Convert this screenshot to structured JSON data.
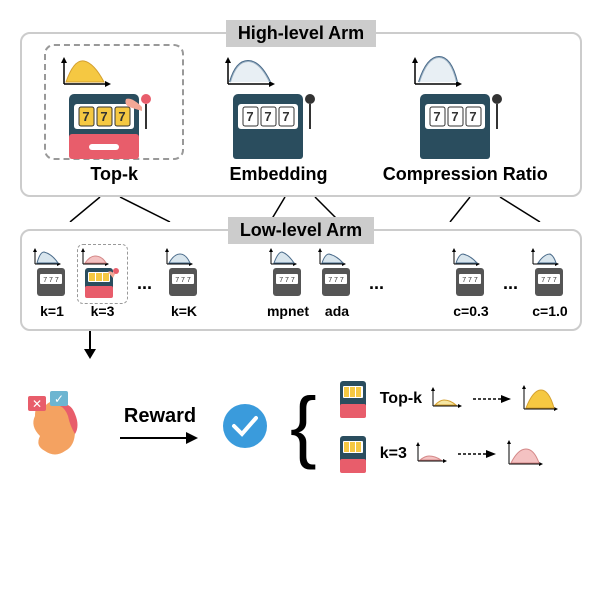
{
  "sections": {
    "high_level": "High-level Arm",
    "low_level": "Low-level Arm"
  },
  "high_arms": [
    {
      "name": "Top-k",
      "selected": true,
      "color": "yellow"
    },
    {
      "name": "Embedding",
      "selected": false,
      "color": "blue"
    },
    {
      "name": "Compression Ratio",
      "selected": false,
      "color": "blue"
    }
  ],
  "low_arms": {
    "topk": [
      {
        "label": "k=1",
        "color": "blue"
      },
      {
        "label": "k=3",
        "color": "pink",
        "selected": true
      },
      {
        "label": "k=K",
        "color": "blue"
      }
    ],
    "embedding": [
      {
        "label": "mpnet",
        "color": "blue"
      },
      {
        "label": "ada",
        "color": "blue"
      }
    ],
    "compression": [
      {
        "label": "c=0.3",
        "color": "blue"
      },
      {
        "label": "c=1.0",
        "color": "blue"
      }
    ]
  },
  "reward_label": "Reward",
  "updates": [
    {
      "label": "Top-k",
      "color": "yellow"
    },
    {
      "label": "k=3",
      "color": "pink"
    }
  ],
  "chart_data": {
    "type": "diagram",
    "description": "Hierarchical multi-armed bandit structure. High-level arms select hyperparameter dimension (Top-k, Embedding, Compression Ratio). Low-level arms select specific values within the chosen dimension. Selected arm (Top-k → k=3) is evaluated and reward updates posterior distributions for both the high-level Top-k arm and low-level k=3 arm.",
    "high_level_options": [
      "Top-k",
      "Embedding",
      "Compression Ratio"
    ],
    "low_level_options": {
      "Top-k": [
        "k=1",
        "k=3",
        "k=K"
      ],
      "Embedding": [
        "mpnet",
        "ada"
      ],
      "Compression Ratio": [
        "c=0.3",
        "c=1.0"
      ]
    },
    "selected_path": [
      "Top-k",
      "k=3"
    ],
    "reward_updates": [
      "Top-k",
      "k=3"
    ]
  }
}
